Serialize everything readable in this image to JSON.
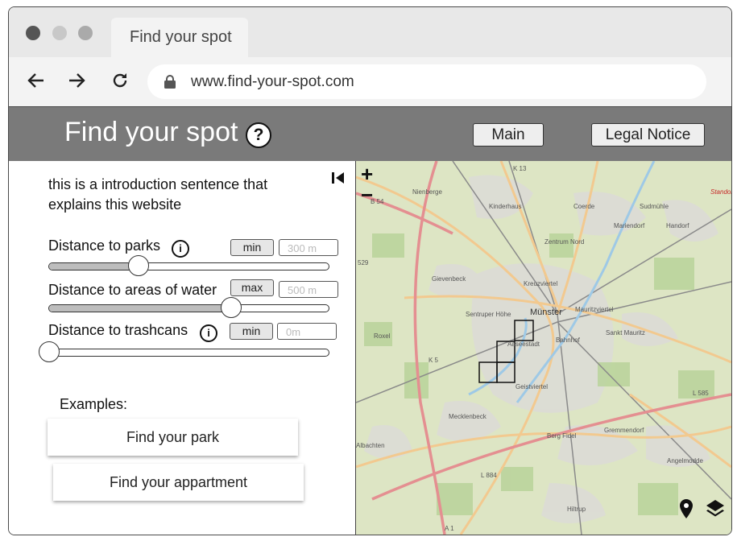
{
  "browser": {
    "tab_title": "Find your spot",
    "url": "www.find-your-spot.com",
    "traffic_lights": [
      "#555555",
      "#c8c8c8",
      "#aaaaaa"
    ]
  },
  "header": {
    "title": "Find your spot",
    "help_icon_glyph": "?",
    "nav": {
      "main": "Main",
      "legal": "Legal Notice"
    }
  },
  "panel": {
    "intro": "this is a introduction sentence that explains this website",
    "filters": [
      {
        "label": "Distance to parks",
        "mode": "min",
        "value_placeholder": "300 m",
        "slider_fraction": 0.32
      },
      {
        "label": "Distance to areas of water",
        "mode": "max",
        "value_placeholder": "500 m",
        "slider_fraction": 0.65
      },
      {
        "label": "Distance to trashcans",
        "mode": "min",
        "value_placeholder": "0m",
        "slider_fraction": 0.0
      }
    ],
    "examples_label": "Examples:",
    "examples": [
      "Find your park",
      "Find your appartment"
    ]
  },
  "map": {
    "zoom_in": "+",
    "zoom_out": "−",
    "labels": [
      "K 13",
      "Nienberge",
      "B 54",
      "Kinderhaus",
      "Coerde",
      "Sudmühle",
      "Standort",
      "Mariendorf",
      "Handorf",
      "Zentrum Nord",
      "529",
      "Gievenbeck",
      "Kreuzviertel",
      "Sentruper Höhe",
      "Münster",
      "Mauritzviertel",
      "Roxel",
      "Aaseestadt",
      "Sankt Mauritz",
      "Bahnhof",
      "Geistviertel",
      "K 5",
      "L 585",
      "Mecklenbeck",
      "Berg Fidel",
      "Gremmendorf",
      "Albachten",
      "L 884",
      "Angelmodde",
      "Hiltrup",
      "A 1"
    ],
    "colors": {
      "land": "#dde5c4",
      "urban": "#dcdcd6",
      "forest": "#b9d39a",
      "motorway": "#e48f91",
      "main_road": "#f2c98f",
      "water": "#9ec9e6",
      "rail": "#8a8a8a"
    }
  }
}
